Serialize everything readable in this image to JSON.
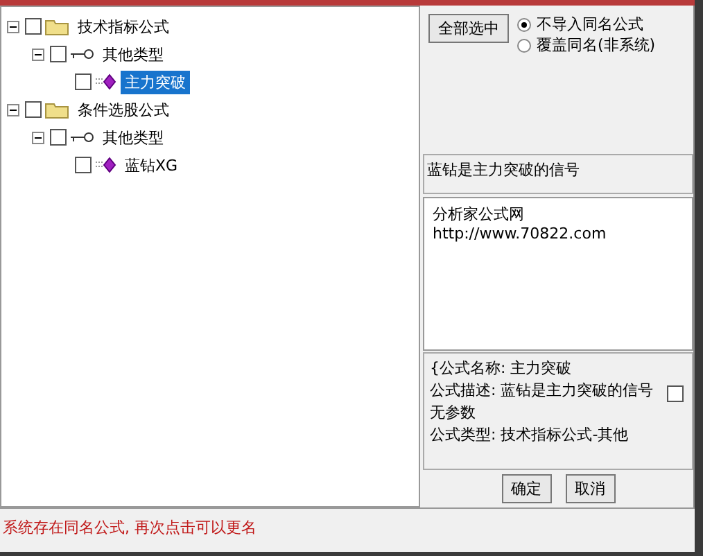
{
  "tree": [
    {
      "label": "技术指标公式",
      "kind": "folder",
      "checked": false,
      "expanded": true,
      "selected": false,
      "children": [
        {
          "label": "其他类型",
          "kind": "type",
          "checked": false,
          "expanded": true,
          "selected": false,
          "children": [
            {
              "label": "主力突破",
              "kind": "formula",
              "checked": false,
              "selected": true
            }
          ]
        }
      ]
    },
    {
      "label": "条件选股公式",
      "kind": "folder",
      "checked": false,
      "expanded": true,
      "selected": false,
      "children": [
        {
          "label": "其他类型",
          "kind": "type",
          "checked": false,
          "expanded": true,
          "selected": false,
          "children": [
            {
              "label": "蓝钻XG",
              "kind": "formula",
              "checked": false,
              "selected": false
            }
          ]
        }
      ]
    }
  ],
  "select_all_button": "全部选中",
  "import_options": [
    {
      "label": "不导入同名公式",
      "selected": true
    },
    {
      "label": "覆盖同名(非系统)",
      "selected": false
    }
  ],
  "description": "蓝钻是主力突破的信号",
  "notes": [
    "分析家公式网",
    "http://www.70822.com"
  ],
  "info": {
    "lines": [
      "{公式名称: 主力突破",
      "公式描述: 蓝钻是主力突破的信号",
      "无参数",
      "公式类型: 技术指标公式-其他"
    ],
    "checked": false
  },
  "buttons": [
    "确定",
    "取消"
  ],
  "status": "系统存在同名公式, 再次点击可以更名"
}
